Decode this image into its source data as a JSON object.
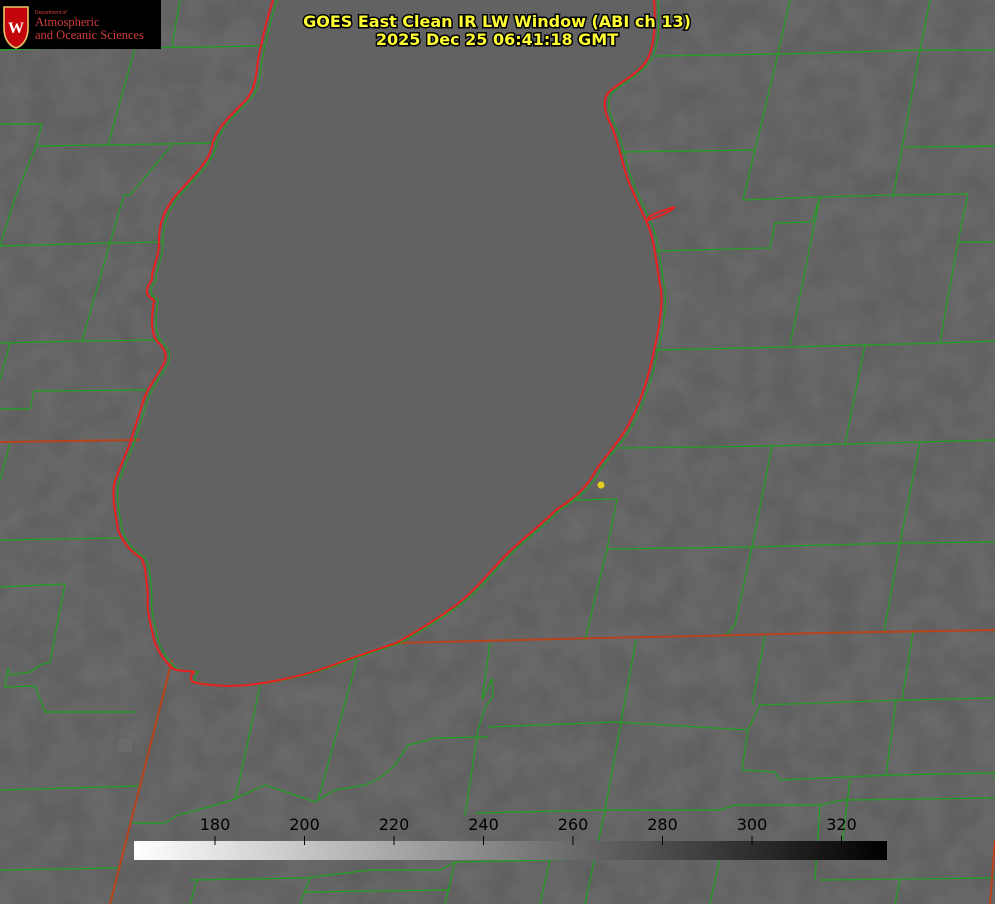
{
  "title": {
    "line1": "GOES East Clean IR LW Window (ABI ch 13)",
    "line2": "2025 Dec 25 06:41:18 GMT"
  },
  "logo": {
    "department": "Department of",
    "name_line1": "Atmospheric",
    "name_line2": "and Oceanic Sciences",
    "emblem": "uw-crest-icon",
    "brand_color": "#c5050c"
  },
  "colorbar": {
    "ticks": [
      "180",
      "200",
      "220",
      "240",
      "260",
      "280",
      "300",
      "320"
    ],
    "gradient": [
      "#ffffff",
      "#000000"
    ]
  },
  "colors": {
    "background": "#5c5c5c",
    "lake": "#626262",
    "county_lines": "#1fa31f",
    "state_lines": "#b8421a",
    "lake_outline": "#e82020",
    "marker": "#e3cc1c",
    "title": "#ffff33"
  }
}
